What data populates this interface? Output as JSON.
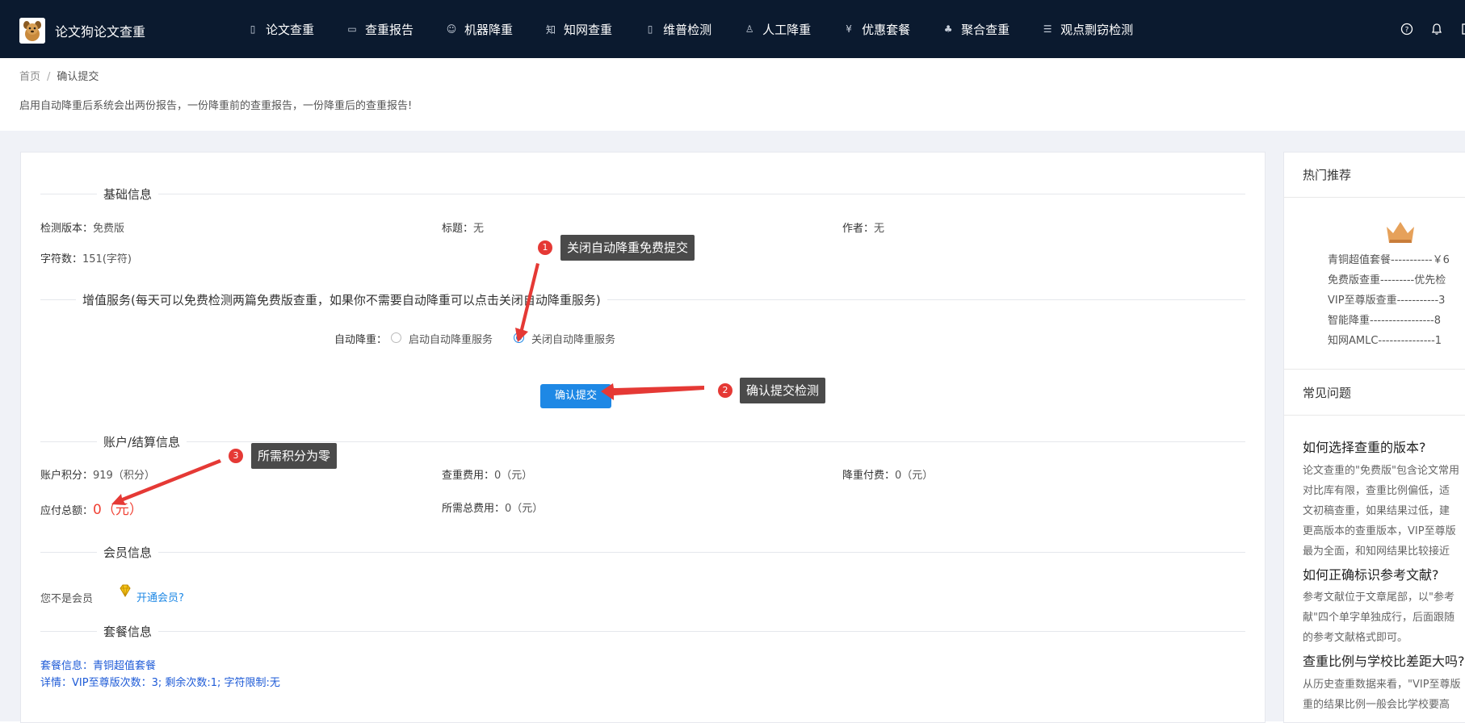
{
  "header": {
    "site_title": "论文狗论文查重",
    "nav": [
      {
        "label": "论文查重",
        "icon": "document-search-icon"
      },
      {
        "label": "查重报告",
        "icon": "report-icon"
      },
      {
        "label": "机器降重",
        "icon": "robot-icon"
      },
      {
        "label": "知网查重",
        "icon": "zhi-icon"
      },
      {
        "label": "维普检测",
        "icon": "book-icon"
      },
      {
        "label": "人工降重",
        "icon": "person-icon"
      },
      {
        "label": "优惠套餐",
        "icon": "yen-icon"
      },
      {
        "label": "聚合查重",
        "icon": "network-icon"
      },
      {
        "label": "观点剽窃检测",
        "icon": "list-icon"
      }
    ]
  },
  "breadcrumb": {
    "home": "首页",
    "separator": "/",
    "current": "确认提交"
  },
  "hint": "启用自动降重后系统会出两份报告，一份降重前的查重报告，一份降重后的查重报告!",
  "basic": {
    "title": "基础信息",
    "version_label": "检测版本：",
    "version_value": "免费版",
    "title_label": "标题：",
    "title_value": "无",
    "author_label": "作者：",
    "author_value": "无",
    "chars_label": "字符数：",
    "chars_value": "151(字符)"
  },
  "value_added": {
    "title": "增值服务(每天可以免费检测两篇免费版查重，如果你不需要自动降重可以点击关闭自动降重服务)",
    "auto_label": "自动降重：",
    "option_on": "启动自动降重服务",
    "option_off": "关闭自动降重服务",
    "selected": "关闭自动降重服务"
  },
  "submit_button": "确认提交",
  "account": {
    "title": "账户/结算信息",
    "points_label": "账户积分：",
    "points_value": "919（积分）",
    "fee_label": "查重费用：",
    "fee_value": "0（元）",
    "reduce_fee_label": "降重付费：",
    "reduce_fee_value": "0（元）",
    "total_label": "应付总额：",
    "total_value": "0（元）",
    "needed_label": "所需总费用：",
    "needed_value": "0（元）"
  },
  "member": {
    "title": "会员信息",
    "status": "您不是会员",
    "open_link": "开通会员?"
  },
  "package": {
    "title": "套餐信息",
    "info": "套餐信息：青铜超值套餐",
    "detail": "详情：VIP至尊版次数：3; 剩余次数:1; 字符限制:无"
  },
  "tips": [
    {
      "num": "1",
      "text": "关闭自动降重免费提交"
    },
    {
      "num": "2",
      "text": "确认提交检测"
    },
    {
      "num": "3",
      "text": "所需积分为零"
    }
  ],
  "side": {
    "hot_title": "热门推荐",
    "packages": [
      "青铜超值套餐-----------￥6",
      "免费版查重---------优先检",
      "VIP至尊版查重-----------3",
      "智能降重-----------------8",
      "知网AMLC---------------1"
    ],
    "faq_title": "常见问题",
    "faqs": [
      {
        "q": "如何选择查重的版本?",
        "lines": [
          "论文查重的\"免费版\"包含论文常用",
          "对比库有限，查重比例偏低，适",
          "文初稿查重，如果结果过低，建",
          "更高版本的查重版本，VIP至尊版",
          "最为全面，和知网结果比较接近"
        ]
      },
      {
        "q": "如何正确标识参考文献?",
        "lines": [
          "参考文献位于文章尾部，以\"参考",
          "献\"四个单字单独成行，后面跟随",
          "的参考文献格式即可。"
        ]
      },
      {
        "q": "查重比例与学校比差距大吗?",
        "lines": [
          "从历史查重数据来看，\"VIP至尊版",
          "重的结果比例一般会比学校要高"
        ]
      }
    ]
  },
  "colors": {
    "nav_bg": "#0b1a2f",
    "primary": "#1e88e5",
    "danger": "#f04134",
    "tip_bg": "#4a4a4a"
  }
}
